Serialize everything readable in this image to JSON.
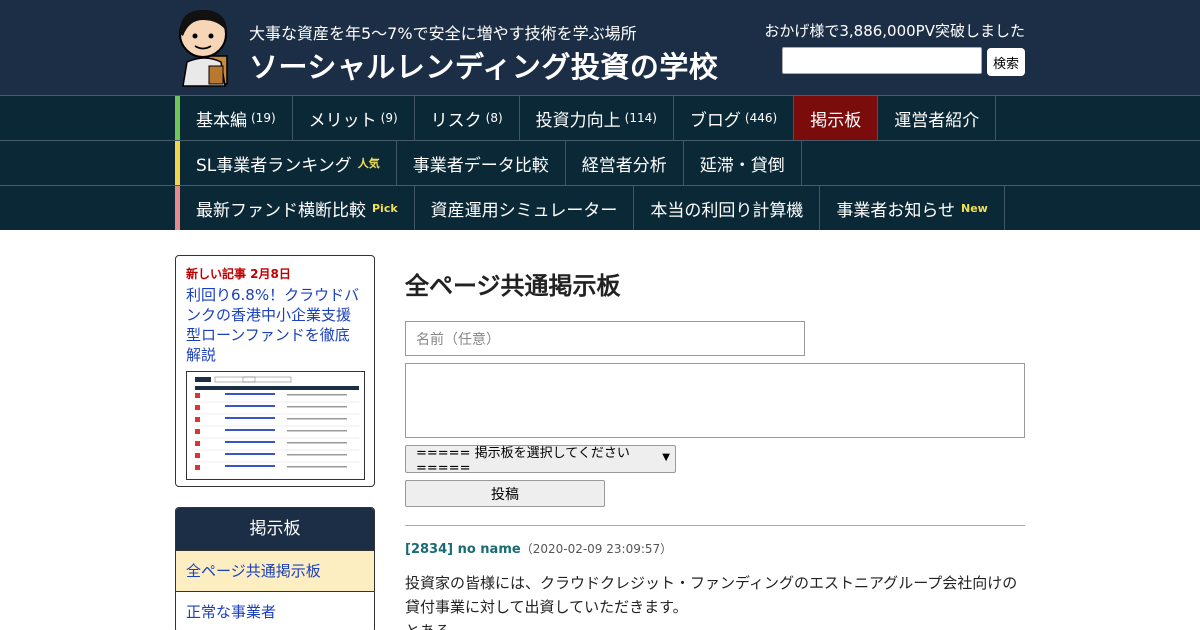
{
  "header": {
    "tagline": "大事な資産を年5～7%で安全に増やす技術を学ぶ場所",
    "title": "ソーシャルレンディング投資の学校",
    "pv_text": "おかげ様で3,886,000PV突破しました",
    "search_button": "検索"
  },
  "nav": {
    "row1": [
      {
        "label": "基本編",
        "count": "(19)"
      },
      {
        "label": "メリット",
        "count": "(9)"
      },
      {
        "label": "リスク",
        "count": "(8)"
      },
      {
        "label": "投資力向上",
        "count": "(114)"
      },
      {
        "label": "ブログ",
        "count": "(446)"
      },
      {
        "label": "掲示板",
        "count": ""
      },
      {
        "label": "運営者紹介",
        "count": ""
      }
    ],
    "row2": [
      {
        "label": "SL事業者ランキング",
        "badge": "人気"
      },
      {
        "label": "事業者データ比較",
        "badge": ""
      },
      {
        "label": "経営者分析",
        "badge": ""
      },
      {
        "label": "延滞・貸倒",
        "badge": ""
      }
    ],
    "row3": [
      {
        "label": "最新ファンド横断比較",
        "badge": "Pick"
      },
      {
        "label": "資産運用シミュレーター",
        "badge": ""
      },
      {
        "label": "本当の利回り計算機",
        "badge": ""
      },
      {
        "label": "事業者お知らせ",
        "badge": "New"
      }
    ]
  },
  "sidebar": {
    "newpost_label": "新しい記事 2月8日",
    "newpost_title": "利回り6.8%！クラウドバンクの香港中小企業支援型ローンファンドを徹底解説",
    "board_heading": "掲示板",
    "board_items": [
      "全ページ共通掲示板",
      "正常な事業者"
    ]
  },
  "main": {
    "title": "全ページ共通掲示板",
    "name_placeholder": "名前（任意）",
    "select_label": "===== 掲示板を選択してください =====",
    "submit_label": "投稿",
    "post": {
      "id": "[2834] no name",
      "time": "（2020-02-09 23:09:57）",
      "line1": "投資家の皆様には、クラウドクレジット・ファンディングのエストニアグループ会社向けの",
      "line2": "貸付事業に対して出資していただきます。",
      "line3": "とある。"
    }
  }
}
